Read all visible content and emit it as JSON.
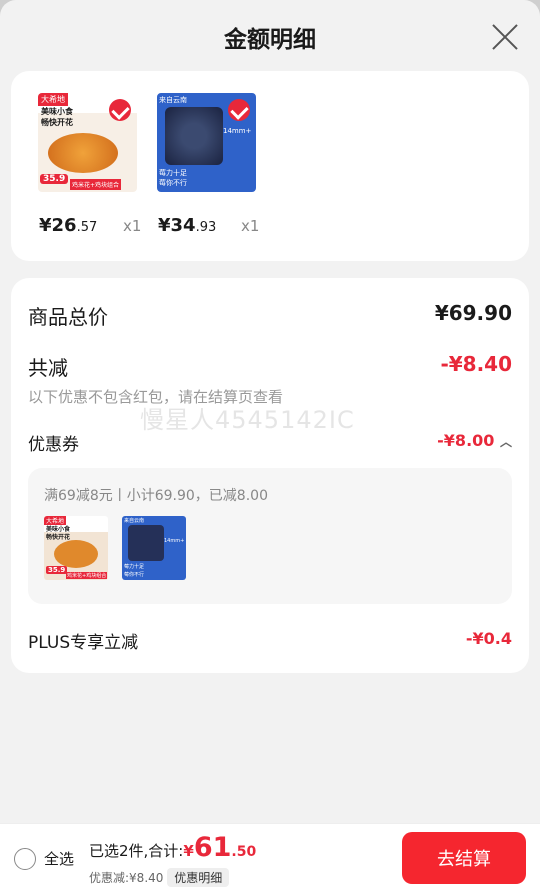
{
  "header": {
    "title": "金额明细"
  },
  "products": [
    {
      "price_int": "¥26",
      "price_dec": ".57",
      "qty": "x1",
      "img_text": {
        "tag": "大希地",
        "line1": "美味小食",
        "line2": "畅快开花",
        "badge": "35.9",
        "bottom": "鸡米花+鸡块组合"
      }
    },
    {
      "price_int": "¥34",
      "price_dec": ".93",
      "qty": "x1",
      "img_text": {
        "tag": "来自云南",
        "line1": "14mm+",
        "bottom1": "莓力十足",
        "bottom2": "莓你不行"
      }
    }
  ],
  "detail": {
    "total_label": "商品总价",
    "total_value": "¥69.90",
    "reduce_label": "共减",
    "reduce_value": "-¥8.40",
    "note": "以下优惠不包含红包，请在结算页查看",
    "coupon_label": "优惠券",
    "coupon_value": "-¥8.00",
    "coupon_desc": "满69减8元丨小计69.90，已减8.00",
    "plus_label": "PLUS专享立减",
    "plus_value": "-¥0.4"
  },
  "watermark": "慢星人4545142IC",
  "footer": {
    "select_all": "全选",
    "selected_text": "已选2件,合计:",
    "currency": "¥",
    "total_int": "61",
    "total_dec": ".50",
    "discount_text": "优惠减:¥8.40",
    "detail_pill": "优惠明细",
    "checkout": "去结算"
  },
  "colors": {
    "accent": "#e8283a",
    "button": "#f5262f"
  }
}
